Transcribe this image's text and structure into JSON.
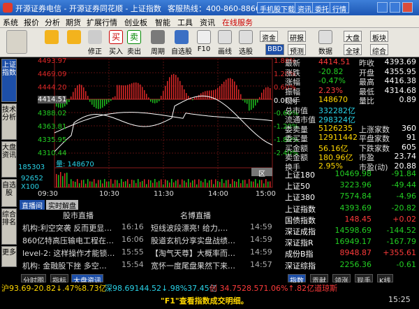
{
  "app": {
    "title": "开源证券电信 - 开源证券同花顺 - 上证指数",
    "hotline": "客服热线：400-860-8866",
    "title_buttons": [
      "手机股下载",
      "资讯",
      "委托",
      "行情"
    ]
  },
  "menu": [
    "系统",
    "报价",
    "分析",
    "期货",
    "扩展行情",
    "创业板",
    "智能",
    "工具",
    "资讯",
    "在线服务"
  ],
  "toolbar": {
    "tools": [
      "",
      "",
      "修正",
      "买入",
      "卖出",
      "周期",
      "自选股",
      "F10",
      "画线",
      "选股"
    ],
    "right_buttons": [
      "资金",
      "BBD",
      "研报",
      "预测",
      "数据",
      "大盘",
      "全球",
      "板块",
      "综合"
    ]
  },
  "vtabs": [
    "上证指数",
    "技术分析",
    "大盘资讯",
    "自选股",
    "综合排名",
    "更多"
  ],
  "chart": {
    "left_axis": [
      "4493.97",
      "4469.09",
      "4444.20",
      "4414.51",
      "4388.02",
      "4363.81",
      "4335.95",
      "4310.44"
    ],
    "right_axis": [
      "1.80%",
      "1.20%",
      "0.60%",
      "0.00%",
      "-0.60%",
      "-1.20%",
      "-1.80%",
      "-2.40%"
    ],
    "volume_label": "量: 148670",
    "vol_ticks": [
      "185303",
      "92652",
      "X100"
    ],
    "time_ticks": [
      "09:30",
      "10:30",
      "11:30",
      "14:00",
      "15:00"
    ],
    "tool_label": "区"
  },
  "quote": {
    "rows": [
      {
        "l": "最新",
        "v": "4414.51",
        "l2": "昨收",
        "v2": "4393.69"
      },
      {
        "l": "涨跌",
        "v": "-20.82",
        "l2": "开盘",
        "v2": "4355.95"
      },
      {
        "l": "涨幅",
        "v": "-0.47%",
        "l2": "最高",
        "v2": "4416.38"
      },
      {
        "l": "振幅",
        "v": "2.23%",
        "l2": "最低",
        "v2": "4314.68"
      },
      {
        "l": "现手",
        "v": "148670",
        "l2": "量比",
        "v2": "0.89"
      },
      {
        "l": "总市值",
        "v": "332282亿"
      },
      {
        "l": "流通市值",
        "v": "298324亿"
      },
      {
        "l": "委卖量",
        "v": "5126235",
        "l2": "上涨家数",
        "v2": "360"
      },
      {
        "l": "委买量",
        "v": "12911442",
        "l2": "平盘家数",
        "v2": "91"
      },
      {
        "l": "买金额",
        "v": "56.16亿",
        "l2": "下跌家数",
        "v2": "605"
      },
      {
        "l": "卖金额",
        "v": "180.96亿",
        "l2": "市盈",
        "v2": "23.74"
      },
      {
        "l": "换手",
        "v": "2.95%",
        "l2": "市盈(动)",
        "v2": "20.88"
      }
    ],
    "indices": [
      {
        "n": "上证180",
        "p": "10469.98",
        "c": "-91.84"
      },
      {
        "n": "上证50",
        "p": "3223.96",
        "c": "-49.44"
      },
      {
        "n": "上证380",
        "p": "7574.84",
        "c": "-4.96"
      },
      {
        "n": "上证指数",
        "p": "4393.69",
        "c": "-20.82"
      },
      {
        "n": "国债指数",
        "p": "148.45",
        "c": "+0.02"
      },
      {
        "n": "深证成指",
        "p": "14598.69",
        "c": "-144.52"
      },
      {
        "n": "深证指R",
        "p": "16949.17",
        "c": "-167.79"
      },
      {
        "n": "成份B指",
        "p": "8948.87",
        "c": "+355.61"
      },
      {
        "n": "深证综指",
        "p": "2256.36",
        "c": "-0.61"
      }
    ]
  },
  "news": {
    "tabs": [
      "直播间",
      "实时解盘"
    ],
    "headers": [
      "股市直播",
      "名博直播"
    ],
    "items": [
      {
        "a": "机构:利空突袭 反而更显…",
        "t": "16:16",
        "b": "短线波段漂亮! 给力,…",
        "tt": "14:59"
      },
      {
        "a": "860亿特高压输电工程在…",
        "t": "16:06",
        "b": "股道玄机分享实盘战绩…",
        "tt": "14:59"
      },
      {
        "a": "level-2: 这样操作才能锁…",
        "t": "15:55",
        "b": "【淘气天尊】大概率而…",
        "tt": "14:59"
      },
      {
        "a": "机构: 金融股下挫 多空…",
        "t": "15:54",
        "b": "宽怀一度尾盘果然下来…",
        "tt": "14:57"
      }
    ]
  },
  "bottom": {
    "tabs": [
      "分时图",
      "指标",
      "大盘资讯"
    ],
    "right_tabs": [
      "指数",
      "贡献",
      "领涨",
      "现手",
      "K线"
    ]
  },
  "status": {
    "sh": "沪93.69-20.82↓.47%8.73亿",
    "sz": "深98.69144.52↓.98%37.45亿",
    "cy": "创 34.7528.571.06%↑.82亿道琼斯"
  },
  "info": {
    "tip": "\"F1\"查看指数成交明细。",
    "time": "15:25"
  }
}
